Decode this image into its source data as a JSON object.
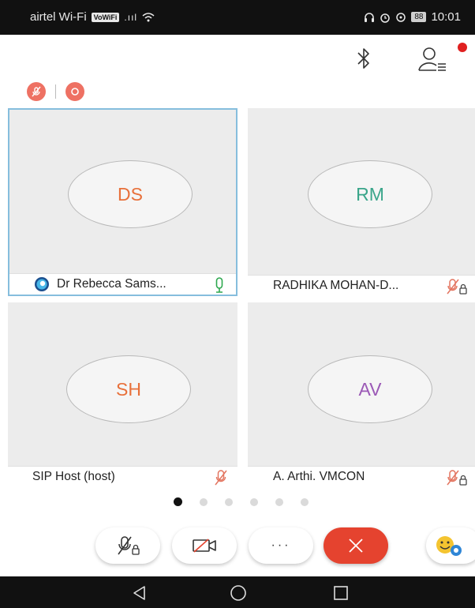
{
  "status_bar": {
    "carrier": "airtel Wi-Fi",
    "volte": "VoWiFi",
    "signal": ".ııl",
    "battery": "88",
    "time": "10:01"
  },
  "header": {
    "bluetooth_icon": "bluetooth-icon",
    "participants_icon": "participants-icon",
    "notification_color": "#e02020"
  },
  "indicators": {
    "mic_icon": "mic-muted-icon",
    "record_icon": "record-icon",
    "color": "#ee7163"
  },
  "participants": [
    {
      "initials": "DS",
      "name": "Dr Rebecca Sams...",
      "initials_color": "#e8703a",
      "mic": "mic-active",
      "active": true
    },
    {
      "initials": "RM",
      "name": "RADHIKA MOHAN-D...",
      "initials_color": "#3aa58a",
      "mic": "mic-muted-locked",
      "active": false
    },
    {
      "initials": "SH",
      "name": "SIP Host (host)",
      "initials_color": "#e8703a",
      "mic": "mic-muted",
      "active": false
    },
    {
      "initials": "AV",
      "name": "A. Arthi. VMCON",
      "initials_color": "#9b59b6",
      "mic": "mic-muted-locked",
      "active": false
    }
  ],
  "pager": {
    "total_pages": 6,
    "current_page": 1
  },
  "controls": {
    "mic_icon": "mic-muted-locked-icon",
    "video_icon": "video-off-icon",
    "more_label": "···",
    "leave_icon": "close-icon",
    "reactions_icon": "emoji-icon",
    "leave_color": "#e5432f"
  }
}
